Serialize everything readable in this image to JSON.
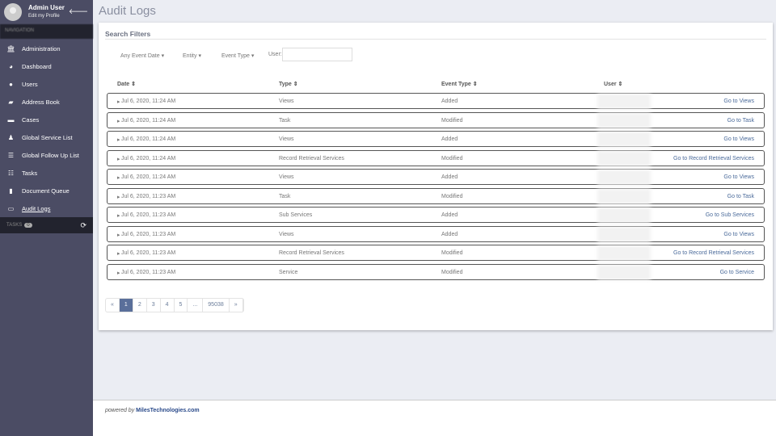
{
  "sidebar": {
    "user_name": "Admin User",
    "edit_profile": "Edit my Profile",
    "nav_header": "NAVIGATION",
    "items": [
      {
        "label": "Administration",
        "icon": "bank-icon"
      },
      {
        "label": "Dashboard",
        "icon": "dashboard-icon"
      },
      {
        "label": "Users",
        "icon": "user-icon"
      },
      {
        "label": "Address Book",
        "icon": "book-icon"
      },
      {
        "label": "Cases",
        "icon": "briefcase-icon"
      },
      {
        "label": "Global Service List",
        "icon": "user-tie-icon"
      },
      {
        "label": "Global Follow Up List",
        "icon": "list-icon"
      },
      {
        "label": "Tasks",
        "icon": "tasks-icon"
      },
      {
        "label": "Document Queue",
        "icon": "file-icon"
      },
      {
        "label": "Audit Logs",
        "icon": "log-icon",
        "active": true
      }
    ],
    "tasks_label": "TASKS",
    "tasks_count": "0"
  },
  "page": {
    "title": "Audit Logs"
  },
  "filters": {
    "title": "Search Filters",
    "event_date": "Any Event Date ▾",
    "entity": "Entity ▾",
    "event_type": "Event Type ▾",
    "user_label": "User:",
    "user_value": ""
  },
  "table": {
    "headers": [
      "Date ⇕",
      "Type ⇕",
      "Event Type ⇕",
      "User ⇕"
    ],
    "rows": [
      {
        "date": "Jul 6, 2020, 11:24 AM",
        "type": "Views",
        "event": "Added",
        "link": "Go to Views"
      },
      {
        "date": "Jul 6, 2020, 11:24 AM",
        "type": "Task",
        "event": "Modified",
        "link": "Go to Task"
      },
      {
        "date": "Jul 6, 2020, 11:24 AM",
        "type": "Views",
        "event": "Added",
        "link": "Go to Views"
      },
      {
        "date": "Jul 6, 2020, 11:24 AM",
        "type": "Record Retrieval Services",
        "event": "Modified",
        "link": "Go to Record Retrieval Services"
      },
      {
        "date": "Jul 6, 2020, 11:24 AM",
        "type": "Views",
        "event": "Added",
        "link": "Go to Views"
      },
      {
        "date": "Jul 6, 2020, 11:23 AM",
        "type": "Task",
        "event": "Modified",
        "link": "Go to Task"
      },
      {
        "date": "Jul 6, 2020, 11:23 AM",
        "type": "Sub Services",
        "event": "Added",
        "link": "Go to Sub Services"
      },
      {
        "date": "Jul 6, 2020, 11:23 AM",
        "type": "Views",
        "event": "Added",
        "link": "Go to Views"
      },
      {
        "date": "Jul 6, 2020, 11:23 AM",
        "type": "Record Retrieval Services",
        "event": "Modified",
        "link": "Go to Record Retrieval Services"
      },
      {
        "date": "Jul 6, 2020, 11:23 AM",
        "type": "Service",
        "event": "Modified",
        "link": "Go to Service"
      }
    ]
  },
  "pagination": {
    "pages": [
      "«",
      "1",
      "2",
      "3",
      "4",
      "5",
      "...",
      "95038",
      "»"
    ],
    "current": "1"
  },
  "footer": {
    "powered": "powered by",
    "brand": "MilesTechnologies.com"
  }
}
